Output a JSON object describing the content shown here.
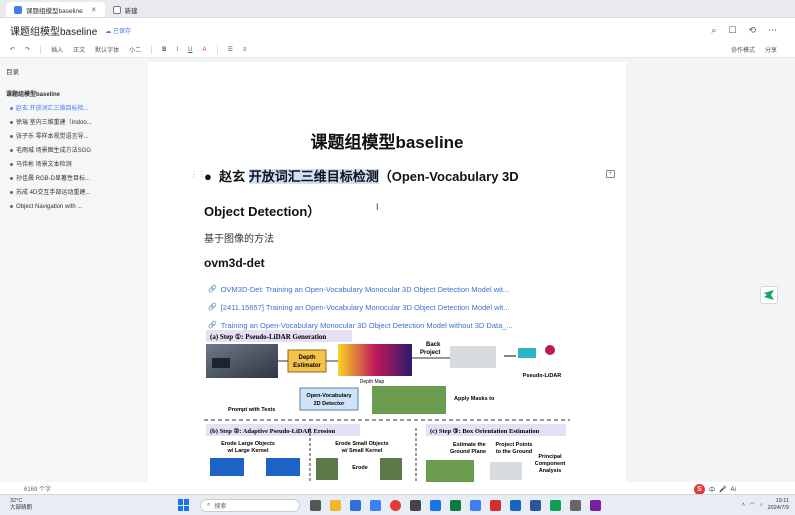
{
  "browser": {
    "tabs": [
      {
        "label": "课题组模型baseline",
        "active": true
      },
      {
        "label": "新建",
        "active": false
      }
    ]
  },
  "document": {
    "title": "课题组模型baseline",
    "saved_label": "已保存",
    "heading": "课题组模型baseline",
    "bullet_name": "赵玄",
    "bullet_highlight": "开放词汇三维目标检测",
    "bullet_rest": "（Open-Vocabulary 3D",
    "bullet_line2": "Object Detection）",
    "paragraph": "基于图像的方法",
    "subheading": "ovm3d-det",
    "links": [
      "OVM3D-Det: Training an Open-Vocabulary Monocular 3D Object Detection Model wit...",
      "[2411.15657] Training an Open-Vocabulary Monocular 3D Object Detection Model wit...",
      "Training an Open-Vocabulary Monocular 3D Object Detection Model without 3D Data_..."
    ],
    "word_count": "6169 个字"
  },
  "toolbar": {
    "items": [
      "插入",
      "正文",
      "默认字体",
      "小二",
      "B",
      "I",
      "U",
      "A"
    ],
    "right_items": [
      "协作模式",
      "分享"
    ]
  },
  "sidebar": {
    "title": "目录",
    "items": [
      {
        "label": "课题组模型baseline",
        "level": 0,
        "active": false
      },
      {
        "label": "赵玄 开放词汇三维目标检...",
        "level": 1,
        "active": true
      },
      {
        "label": "徐瑞 室内三维重建（Indoo...",
        "level": 1,
        "active": false
      },
      {
        "label": "张子乐 零样本视觉语言导...",
        "level": 1,
        "active": false
      },
      {
        "label": "毛雨城 场景图生成方法SGG",
        "level": 1,
        "active": false
      },
      {
        "label": "马伟彬 场景文本检测",
        "level": 1,
        "active": false
      },
      {
        "label": "孙佳晨 RGB-D显著性目标...",
        "level": 1,
        "active": false
      },
      {
        "label": "苏成 4D交互手部运动重建...",
        "level": 1,
        "active": false
      },
      {
        "label": "Object Navigation with ...",
        "level": 1,
        "active": false
      }
    ]
  },
  "figure": {
    "step1": "(a) Step ①: Pseudo-LiDAR Generation",
    "depth_estimator": "Depth Estimator",
    "depth_map": "Depth Map",
    "back_project": "Back Project",
    "pseudo_lidar": "Pseudo-LiDAR",
    "detector": "Open-Vocabulary 2D Detector",
    "prompt": "Prompt with Texts",
    "apply_masks": "Apply Masks to",
    "step2": "(b) Step ②: Adaptive Pseudo-LiDAR Erosion",
    "erode_large": "Erode Large Objects w/ Large Kernel",
    "erode_small": "Erode Small Objects w/ Small Kernel",
    "erode": "Erode",
    "step3": "(c) Step ③: Box Orientation Estimation",
    "ground_plane": "Estimate the Ground Plane",
    "project_ground": "Project Points to the Ground",
    "pca": "Principal Component Analysis"
  },
  "taskbar": {
    "weather_temp": "32°C",
    "weather_desc": "大部晴朗",
    "search_placeholder": "搜索",
    "time": "19:11",
    "date": "2024/7/9",
    "ime": "中",
    "ai": "Ai"
  },
  "colors": {
    "accent": "#3d7ff5",
    "highlight": "#cfe0fb",
    "link": "#3d6fd9"
  }
}
